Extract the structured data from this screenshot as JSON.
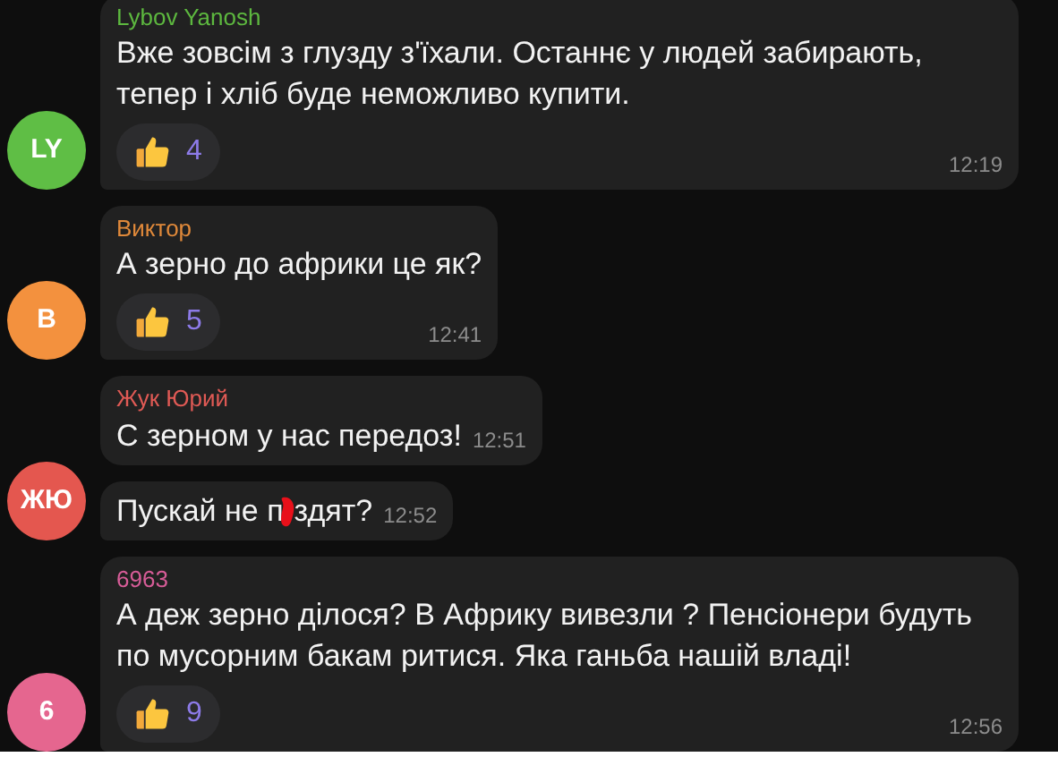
{
  "groups": [
    {
      "avatar": {
        "initials": "LY",
        "color": "#5fbe45"
      },
      "messages": [
        {
          "kind": "plain",
          "author": "Lybov Yanosh",
          "color": "#5db83f",
          "text": "Вже зовсім з глузду з'їхали. Останнє у людей забирають, тепер і хліб буде неможливо купити.",
          "reaction": {
            "count": "4"
          },
          "time": "12:19"
        }
      ]
    },
    {
      "avatar": {
        "initials": "В",
        "color": "#f3913e"
      },
      "messages": [
        {
          "kind": "plain",
          "author": "Виктор",
          "color": "#e0893a",
          "text": "А зерно до африки це як?",
          "reaction": {
            "count": "5"
          },
          "time": "12:41"
        }
      ]
    },
    {
      "avatar": {
        "initials": "ЖЮ",
        "color": "#e4574f"
      },
      "messages": [
        {
          "kind": "plain",
          "author": "Жук Юрий",
          "color": "#e05a55",
          "text": "С зерном у нас передоз!",
          "time": "12:51"
        },
        {
          "kind": "censored",
          "parts": [
            "Пускай не п",
            "здят?"
          ],
          "time": "12:52"
        }
      ]
    },
    {
      "avatar": {
        "initials": "6",
        "color": "#e5668f"
      },
      "messages": [
        {
          "kind": "plain",
          "author": "6963",
          "color": "#d65c97",
          "text": "А деж зерно ділося? В Африку вивезли ? Пенсіонери будуть по мусорним бакам ритися. Яка ганьба нашій владі!",
          "reaction": {
            "count": "9"
          },
          "time": "12:56"
        }
      ]
    }
  ]
}
